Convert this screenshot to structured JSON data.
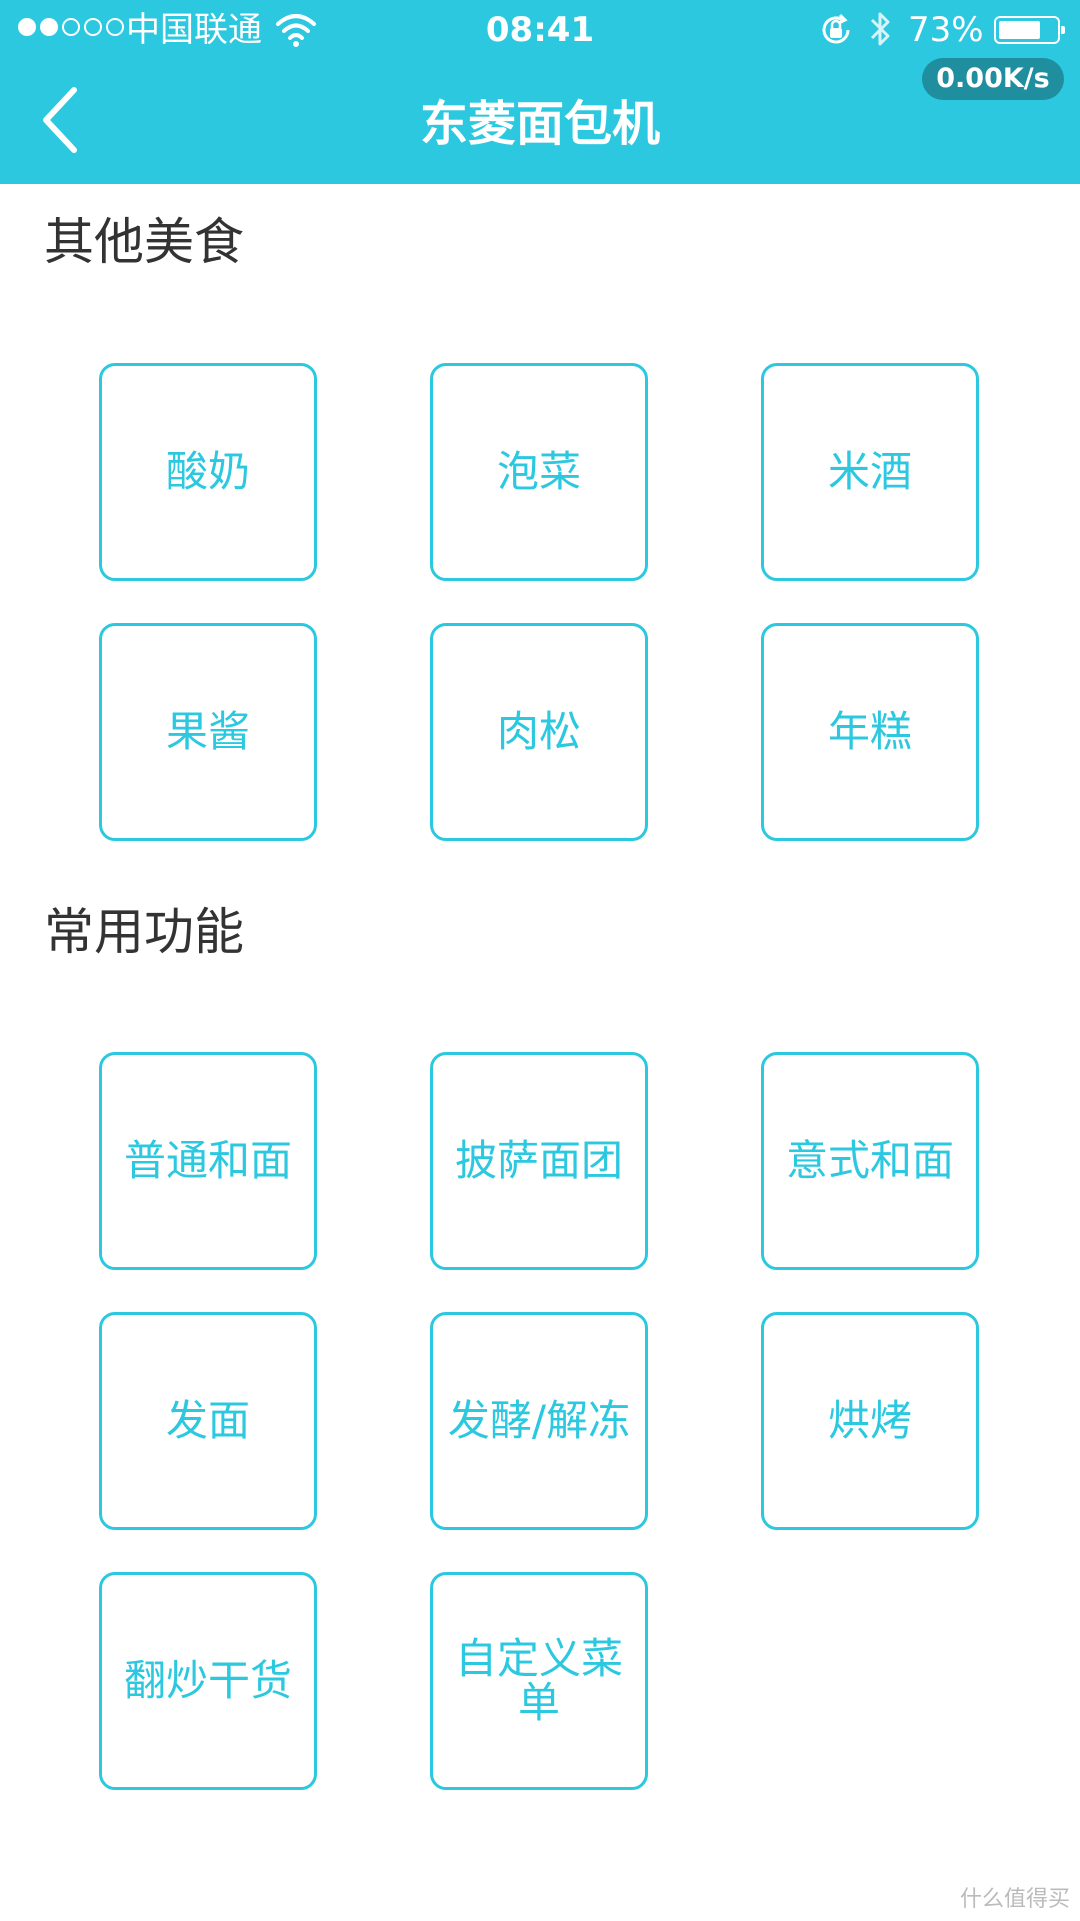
{
  "status_bar": {
    "carrier": "中国联通",
    "time": "08:41",
    "battery_percent": "73%",
    "battery_level": 0.73,
    "network_speed": "0.00K/s",
    "signal_bars_filled": 2,
    "signal_bars_total": 5
  },
  "header": {
    "title": "东菱面包机"
  },
  "sections": [
    {
      "title": "其他美食",
      "items": [
        "酸奶",
        "泡菜",
        "米酒",
        "果酱",
        "肉松",
        "年糕"
      ]
    },
    {
      "title": "常用功能",
      "items": [
        "普通和面",
        "披萨面团",
        "意式和面",
        "发面",
        "发酵/解冻",
        "烘烤",
        "翻炒干货",
        "自定义菜单"
      ]
    }
  ],
  "watermark": "什么值得买",
  "colors": {
    "accent": "#2bc8e0",
    "text": "#333333",
    "badge": "#1f8fa0"
  }
}
